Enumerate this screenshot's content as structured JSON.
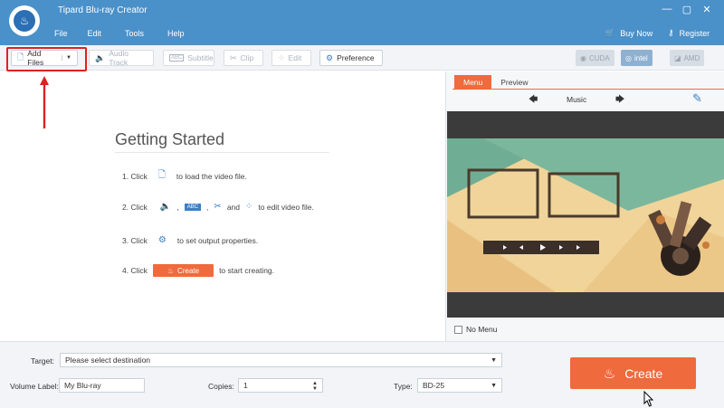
{
  "app": {
    "title": "Tipard Blu-ray Creator"
  },
  "menu": {
    "file": "File",
    "edit": "Edit",
    "tools": "Tools",
    "help": "Help"
  },
  "header_links": {
    "buy_now": "Buy Now",
    "register": "Register"
  },
  "window_controls": {
    "minimize": "—",
    "restore": "▢",
    "close": "✕"
  },
  "toolbar": {
    "add_files": "Add Files",
    "audio_track": "Audio Track",
    "subtitle": "Subtitle",
    "clip": "Clip",
    "edit": "Edit",
    "preference": "Preference",
    "accel_cuda": "CUDA",
    "accel_intel": "intel",
    "accel_amd": "AMD"
  },
  "getting_started": {
    "title": "Getting Started",
    "step1_pre": "1. Click",
    "step1_post": "to load the video file.",
    "step2_pre": "2. Click",
    "step2_comma1": ",",
    "step2_comma2": ",",
    "step2_and": "and",
    "step2_post": "to edit video file.",
    "step3_pre": "3. Click",
    "step3_post": "to set output properties.",
    "step4_pre": "4. Click",
    "step4_button": "Create",
    "step4_post": "to start creating."
  },
  "preview_panel": {
    "tab_menu": "Menu",
    "tab_preview": "Preview",
    "nav_prev": "🡄",
    "nav_next": "🡆",
    "nav_label": "Music",
    "no_menu": "No Menu"
  },
  "bottom": {
    "target_label": "Target:",
    "target_value": "Please select destination",
    "volume_label": "Volume Label:",
    "volume_value": "My Blu-ray",
    "copies_label": "Copies:",
    "copies_value": "1",
    "type_label": "Type:",
    "type_value": "BD-25",
    "create_label": "Create"
  },
  "colors": {
    "titlebar": "#4a90c9",
    "accent_orange": "#ef6a3d",
    "highlight_red": "#e02020",
    "icon_blue": "#3d7fc6"
  }
}
